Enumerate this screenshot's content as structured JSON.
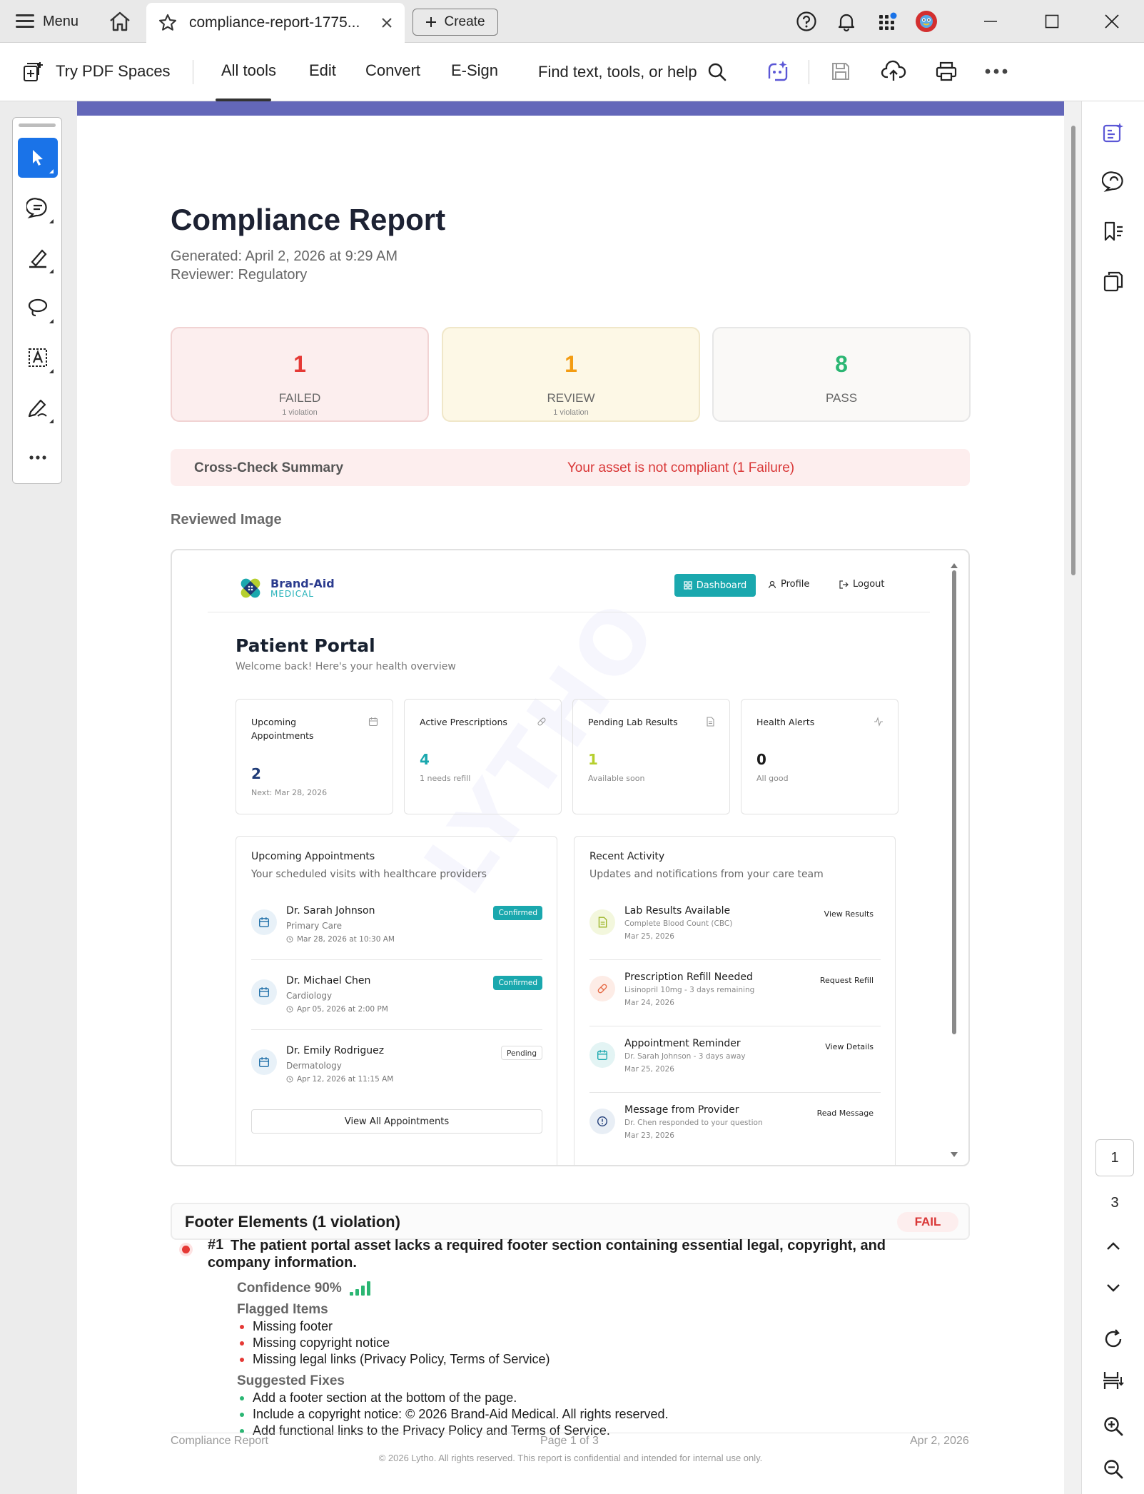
{
  "titlebar": {
    "menu_label": "Menu",
    "tab_title": "compliance-report-1775...",
    "create_label": "Create"
  },
  "toolbar": {
    "try_spaces": "Try PDF Spaces",
    "tabs": [
      "All tools",
      "Edit",
      "Convert",
      "E-Sign"
    ],
    "active_tab": "All tools",
    "search_label": "Find text, tools, or help"
  },
  "report": {
    "title": "Compliance Report",
    "generated": "Generated: April 2, 2026 at 9:29 AM",
    "reviewer": "Reviewer: Regulatory",
    "stats": [
      {
        "value": "1",
        "label": "FAILED",
        "sub": "1 violation",
        "color": "#e53935"
      },
      {
        "value": "1",
        "label": "REVIEW",
        "sub": "1 violation",
        "color": "#f39c12"
      },
      {
        "value": "8",
        "label": "PASS",
        "sub": "",
        "color": "#2bb673"
      }
    ],
    "cross_check_label": "Cross-Check Summary",
    "cross_check_msg": "Your asset is not compliant (1 Failure)",
    "reviewed_heading": "Reviewed Image"
  },
  "shot": {
    "watermark": "LYTHO",
    "brand_name": "Brand-Aid",
    "brand_sub": "MEDICAL",
    "nav": {
      "dashboard": "Dashboard",
      "profile": "Profile",
      "logout": "Logout"
    },
    "portal_title": "Patient Portal",
    "portal_sub": "Welcome back! Here's your health overview",
    "kpis": [
      {
        "title": "Upcoming Appointments",
        "value": "2",
        "sub": "Next: Mar 28, 2026",
        "color": "#1f3b77"
      },
      {
        "title": "Active Prescriptions",
        "value": "4",
        "sub": "1 needs refill",
        "color": "#1aa8ae"
      },
      {
        "title": "Pending Lab Results",
        "value": "1",
        "sub": "Available soon",
        "color": "#b6cf2e"
      },
      {
        "title": "Health Alerts",
        "value": "0",
        "sub": "All good",
        "color": "#1b1b1b"
      }
    ],
    "appointments": {
      "title": "Upcoming Appointments",
      "sub": "Your scheduled visits with healthcare providers",
      "items": [
        {
          "name": "Dr. Sarah Johnson",
          "spec": "Primary Care",
          "time": "Mar 28, 2026 at 10:30 AM",
          "status": "Confirmed"
        },
        {
          "name": "Dr. Michael Chen",
          "spec": "Cardiology",
          "time": "Apr 05, 2026 at 2:00 PM",
          "status": "Confirmed"
        },
        {
          "name": "Dr. Emily Rodriguez",
          "spec": "Dermatology",
          "time": "Apr 12, 2026 at 11:15 AM",
          "status": "Pending"
        }
      ],
      "view_all": "View All Appointments"
    },
    "activity": {
      "title": "Recent Activity",
      "sub": "Updates and notifications from your care team",
      "items": [
        {
          "name": "Lab Results Available",
          "desc": "Complete Blood Count (CBC)",
          "date": "Mar 25, 2026",
          "action": "View Results"
        },
        {
          "name": "Prescription Refill Needed",
          "desc": "Lisinopril 10mg - 3 days remaining",
          "date": "Mar 24, 2026",
          "action": "Request Refill"
        },
        {
          "name": "Appointment Reminder",
          "desc": "Dr. Sarah Johnson - 3 days away",
          "date": "Mar 25, 2026",
          "action": "View Details"
        },
        {
          "name": "Message from Provider",
          "desc": "Dr. Chen responded to your question",
          "date": "Mar 23, 2026",
          "action": "Read Message"
        }
      ]
    }
  },
  "violations": {
    "section_title": "Footer Elements (1 violation)",
    "status": "FAIL",
    "item_number": "#1",
    "item_text_line1": "The patient portal asset lacks a required footer section containing essential legal, copyright, and",
    "item_text_line2": "company information.",
    "confidence": "Confidence 90%",
    "confidence_level": 0.9,
    "flagged_heading": "Flagged Items",
    "flagged": [
      "Missing footer",
      "Missing copyright notice",
      "Missing legal links (Privacy Policy, Terms of Service)"
    ],
    "fixes_heading": "Suggested Fixes",
    "fixes": [
      "Add a footer section at the bottom of the page.",
      "Include a copyright notice: © 2026 Brand-Aid Medical. All rights reserved.",
      "Add functional links to the Privacy Policy and Terms of Service."
    ]
  },
  "page_footer": {
    "left": "Compliance Report",
    "center": "Page 1 of 3",
    "right": "Apr 2, 2026",
    "copyright": "© 2026 Lytho. All rights reserved. This report is confidential and intended for internal use only."
  },
  "pager": {
    "current": "1",
    "total": "3"
  },
  "colors": {
    "accent": "#6367b9",
    "fail": "#e53935",
    "review": "#f39c12",
    "pass": "#2bb673",
    "teal": "#1aa8ae"
  }
}
